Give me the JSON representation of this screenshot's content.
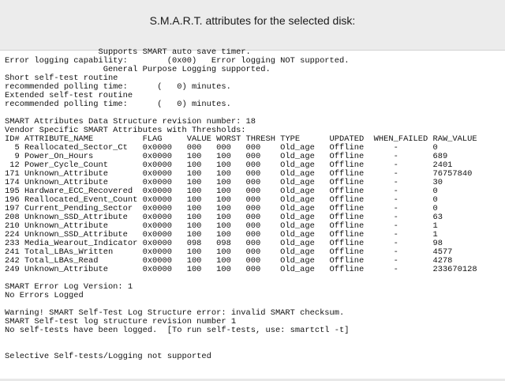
{
  "window": {
    "title": "S.M.A.R.T. attributes for the selected disk:"
  },
  "output": {
    "text": "                   Supports SMART auto save timer.\nError logging capability:        (0x00)   Error logging NOT supported.\n                    General Purpose Logging supported.\nShort self-test routine\nrecommended polling time:      (   0) minutes.\nExtended self-test routine\nrecommended polling time:      (   0) minutes.\n\nSMART Attributes Data Structure revision number: 18\nVendor Specific SMART Attributes with Thresholds:\nID# ATTRIBUTE_NAME          FLAG     VALUE WORST THRESH TYPE      UPDATED  WHEN_FAILED RAW_VALUE\n  5 Reallocated_Sector_Ct   0x0000   000   000   000    Old_age   Offline      -       0\n  9 Power_On_Hours          0x0000   100   100   000    Old_age   Offline      -       689\n 12 Power_Cycle_Count       0x0000   100   100   000    Old_age   Offline      -       2401\n171 Unknown_Attribute       0x0000   100   100   000    Old_age   Offline      -       76757840\n174 Unknown_Attribute       0x0000   100   100   000    Old_age   Offline      -       30\n195 Hardware_ECC_Recovered  0x0000   100   100   000    Old_age   Offline      -       0\n196 Reallocated_Event_Count 0x0000   100   100   000    Old_age   Offline      -       0\n197 Current_Pending_Sector  0x0000   100   100   000    Old_age   Offline      -       0\n208 Unknown_SSD_Attribute   0x0000   100   100   000    Old_age   Offline      -       63\n210 Unknown_Attribute       0x0000   100   100   000    Old_age   Offline      -       1\n224 Unknown_SSD_Attribute   0x0000   100   100   000    Old_age   Offline      -       1\n233 Media_Wearout_Indicator 0x0000   098   098   000    Old_age   Offline      -       98\n241 Total_LBAs_Written      0x0000   100   100   000    Old_age   Offline      -       4577\n242 Total_LBAs_Read         0x0000   100   100   000    Old_age   Offline      -       4278\n249 Unknown_Attribute       0x0000   100   100   000    Old_age   Offline      -       233670128\n\nSMART Error Log Version: 1\nNo Errors Logged\n\nWarning! SMART Self-Test Log Structure error: invalid SMART checksum.\nSMART Self-test log structure revision number 1\nNo self-tests have been logged.  [To run self-tests, use: smartctl -t]\n\n\nSelective Self-tests/Logging not supported"
  }
}
